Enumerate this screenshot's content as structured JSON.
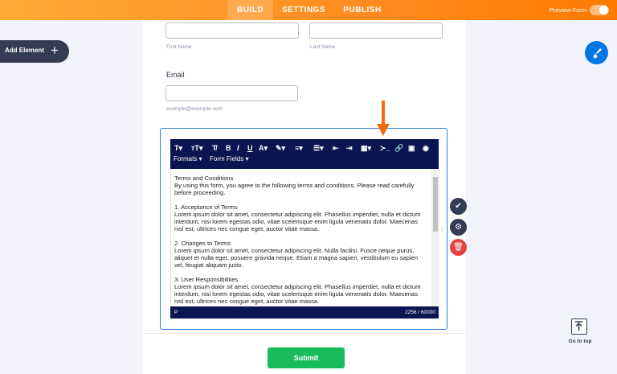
{
  "topbar": {
    "tabs": [
      {
        "label": "BUILD",
        "active": true
      },
      {
        "label": "SETTINGS",
        "active": false
      },
      {
        "label": "PUBLISH",
        "active": false
      }
    ],
    "preview_label": "Preview Form",
    "brand_color": "#ff8b1f"
  },
  "sidebar": {
    "add_element_label": "Add Element",
    "add_icon": "plus-icon"
  },
  "form": {
    "first_name_sub": "First Name",
    "last_name_sub": "Last Name",
    "email_label": "Email",
    "email_sub": "example@example.com",
    "submit_label": "Submit"
  },
  "editor": {
    "toolbar_row2": [
      "Formats ▾",
      "Form Fields ▾"
    ],
    "content": [
      "Terms and Conditions\nBy using this form, you agree to the following terms and conditions. Please read carefully before proceeding.",
      "1. Acceptance of Terms\nLorem ipsum dolor sit amet, consectetur adipiscing elit. Phasellus imperdiet, nulla et dictum interdum, nisi lorem egestas odio, vitae scelerisque enim ligula venenatis dolor. Maecenas nisl est, ultrices nec congue eget, auctor vitae massa.",
      "2. Changes to Terms\nLorem ipsum dolor sit amet, consectetur adipiscing elit. Nulla facilisi. Fusce neque purus, aliquet et nulla eget, posuere gravida neque. Etiam a magna sapien, vestibulum eu sapien vel, feugiat aliquam justo.",
      "3. User Responsibilities\nLorem ipsum dolor sit amet, consectetur adipiscing elit. Phasellus imperdiet, nulla et dictum interdum, nisi lorem egestas odio, vitae scelerisque enim ligula venenatis dolor. Maecenas nisl est, ultrices nec congue eget, auctor vitae massa."
    ],
    "path": "P",
    "char_count": "2256 / 60000"
  },
  "right_panel": {
    "goto_label": "Go to top"
  },
  "colors": {
    "selection": "#2e7fd6",
    "toolbar": "#0a1551",
    "submit": "#18bd5b",
    "arrow": "#f26a0c"
  }
}
